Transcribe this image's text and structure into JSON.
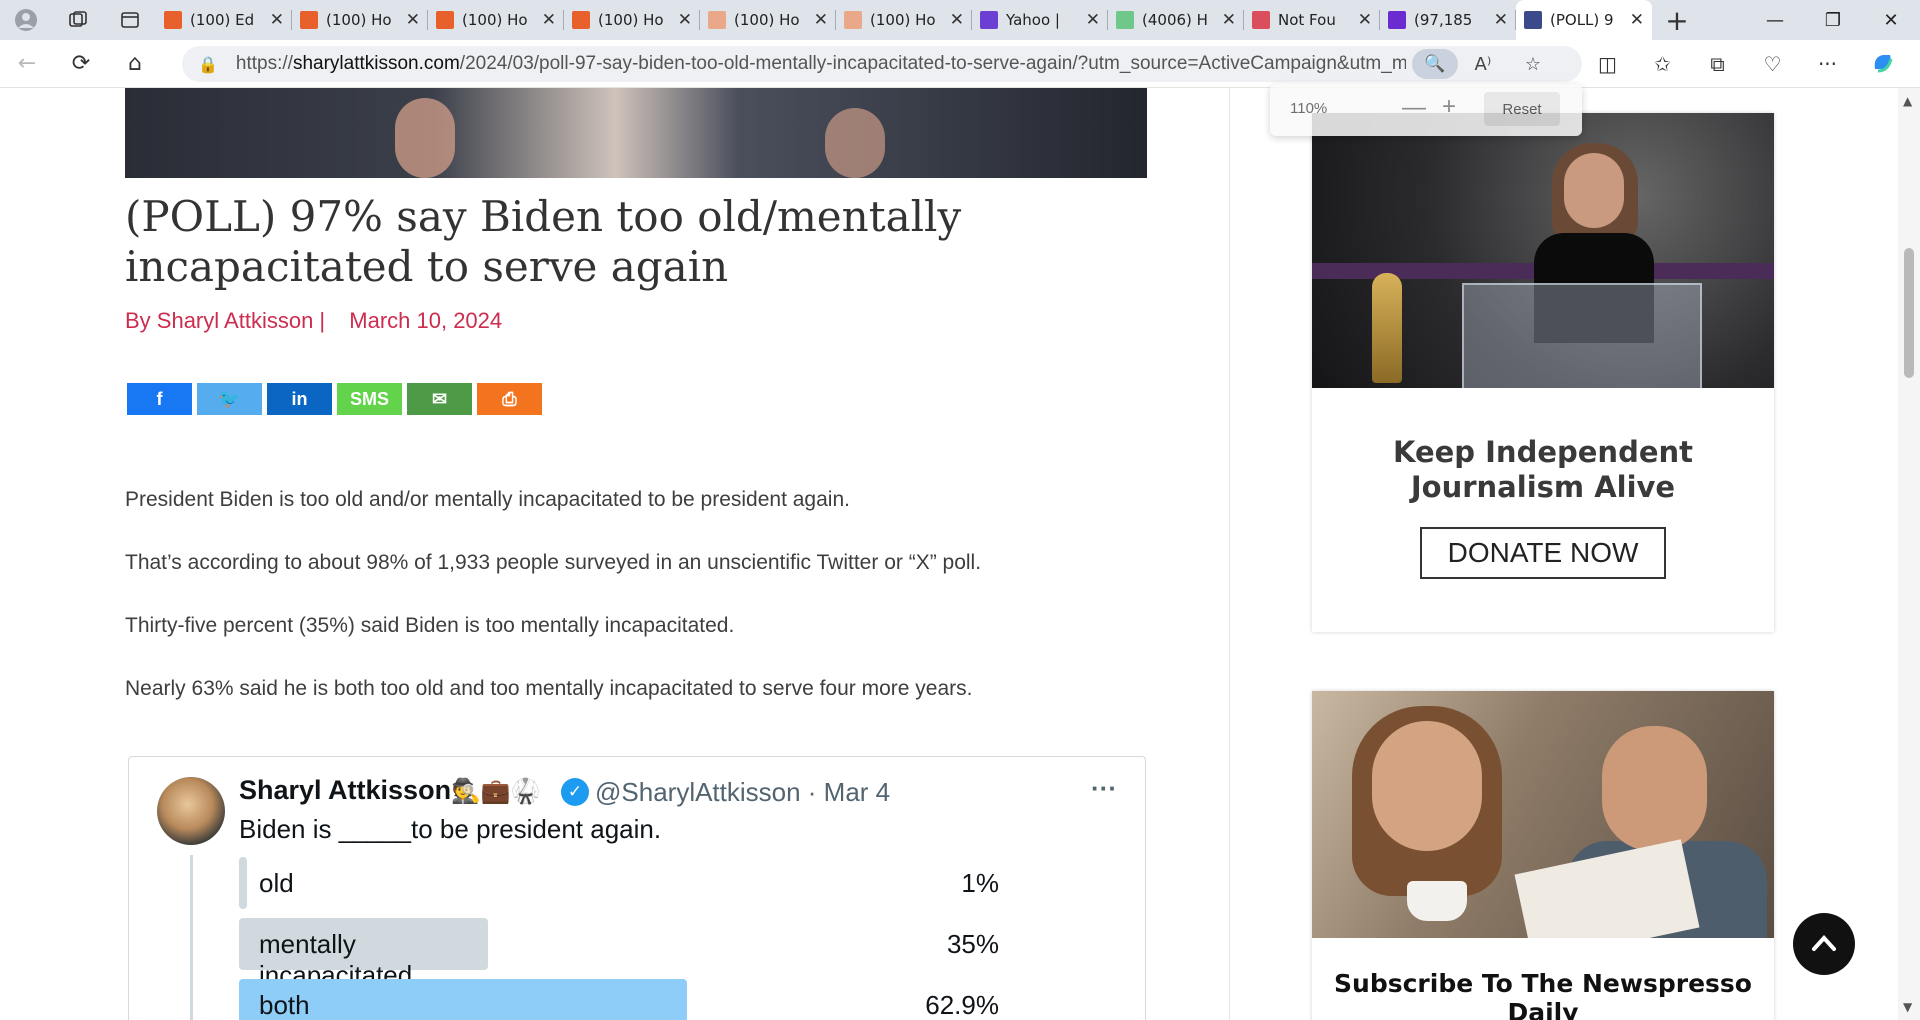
{
  "browser": {
    "tabs": [
      {
        "label": "(100) Ed",
        "icon": "bookmark-icon",
        "color": "#e8602c"
      },
      {
        "label": "(100) Ho",
        "icon": "bookmark-icon",
        "color": "#e8602c"
      },
      {
        "label": "(100) Ho",
        "icon": "bookmark-icon",
        "color": "#e8602c"
      },
      {
        "label": "(100) Ho",
        "icon": "bookmark-icon",
        "color": "#e8602c"
      },
      {
        "label": "(100) Ho",
        "icon": "bookmark-icon",
        "color": "#e9a889"
      },
      {
        "label": "(100) Ho",
        "icon": "bookmark-icon",
        "color": "#e9a889"
      },
      {
        "label": "Yahoo | ",
        "icon": "yahoo-icon",
        "color": "#6b3fd4"
      },
      {
        "label": "(4006) H",
        "icon": "g-icon",
        "color": "#6ec88a"
      },
      {
        "label": "Not Fou",
        "icon": "podcast-icon",
        "color": "#d94f5c"
      },
      {
        "label": "(97,185",
        "icon": "mail-icon",
        "color": "#6b2bd1"
      },
      {
        "label": "(POLL) 9",
        "icon": "site-icon",
        "color": "#3b4a8a"
      }
    ],
    "url_prefix": "https://",
    "url_host": "sharylattkisson.com",
    "url_path": "/2024/03/poll-97-say-biden-too-old-mentally-incapacitated-to-serve-again/?utm_source=ActiveCampaign&utm_medium=e...",
    "zoom": {
      "value": "110%",
      "reset_label": "Reset"
    }
  },
  "article": {
    "title": "(POLL) 97% say Biden too old/mentally incapacitated to serve again",
    "author": "By Sharyl Attkisson |",
    "date": "March 10, 2024",
    "share": [
      {
        "name": "facebook",
        "glyph": "f",
        "color": "#1877f2"
      },
      {
        "name": "twitter",
        "glyph": "🐦",
        "color": "#55acee"
      },
      {
        "name": "linkedin",
        "glyph": "in",
        "color": "#0a66c2"
      },
      {
        "name": "sms",
        "glyph": "SMS",
        "color": "#63d34b"
      },
      {
        "name": "email",
        "glyph": "✉",
        "color": "#4d9a47"
      },
      {
        "name": "print",
        "glyph": "⎙",
        "color": "#f4731f"
      }
    ],
    "paragraphs": [
      "President Biden is too old and/or mentally incapacitated to be president again.",
      "That’s according to about 98% of 1,933 people surveyed in an unscientific Twitter or “X” poll.",
      "Thirty-five percent (35%) said Biden is too mentally incapacitated.",
      "Nearly 63% said he is both too old and too mentally incapacitated to serve four more years."
    ]
  },
  "tweet": {
    "name": "Sharyl Attkisson",
    "emoji": "🕵💼🥋",
    "handle": "@SharylAttkisson · Mar 4",
    "text": "Biden is _____to be president again.",
    "poll": [
      {
        "label": "old",
        "pct": "1%",
        "share": 0.01
      },
      {
        "label": "mentally incapacitated",
        "pct": "35%",
        "share": 0.35
      },
      {
        "label": "both",
        "pct": "62.9%",
        "share": 0.629
      }
    ]
  },
  "sidebar": {
    "donate_heading": "Keep Independent Journalism Alive",
    "donate_button": "DONATE NOW",
    "newsletter_heading": "Subscribe To The Newspresso Daily"
  }
}
